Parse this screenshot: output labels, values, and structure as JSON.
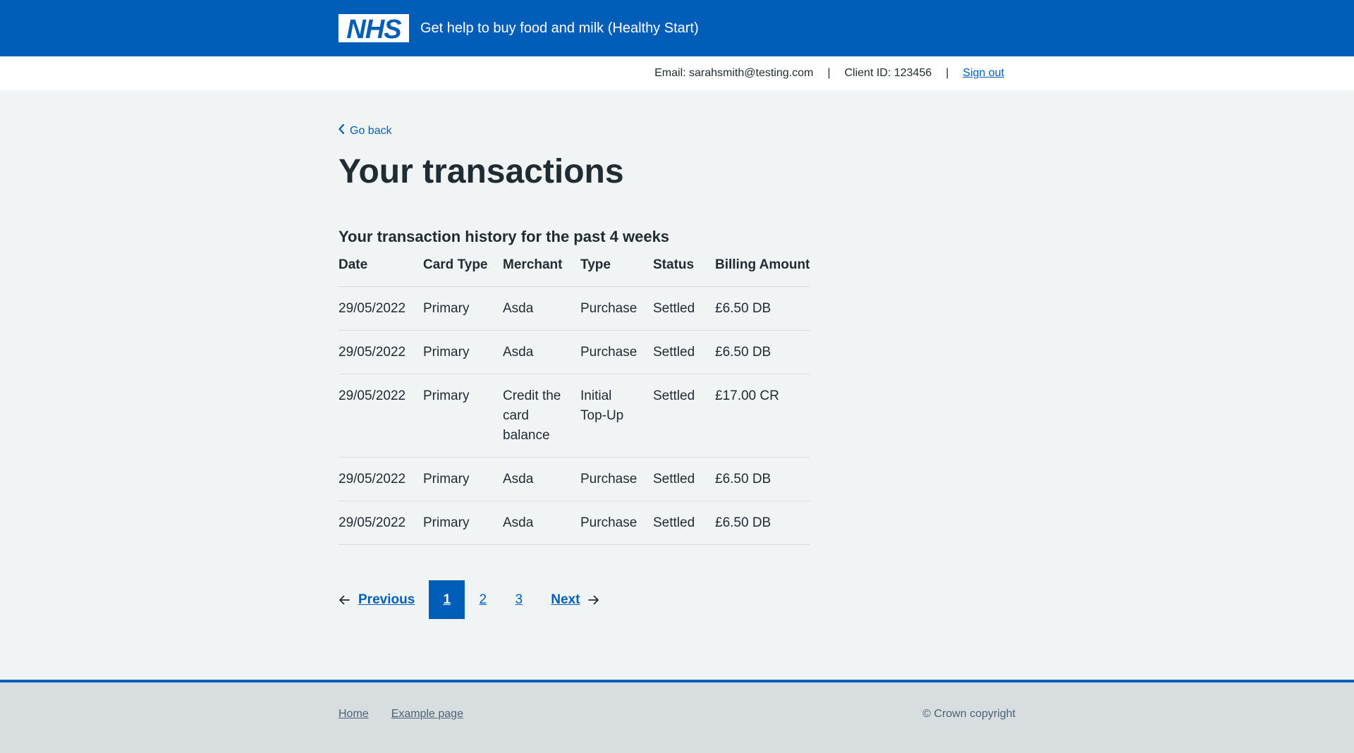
{
  "header": {
    "logo_text": "NHS",
    "service_name": "Get help to buy food and milk (Healthy Start)"
  },
  "account": {
    "email": "Email: sarahsmith@testing.com",
    "separator": "|",
    "client_id": "Client ID: 123456",
    "sign_out": "Sign out"
  },
  "back_link": "Go back",
  "page_title": "Your transactions",
  "table": {
    "caption": "Your transaction history for the past 4 weeks",
    "headers": [
      "Date",
      "Card Type",
      "Merchant",
      "Type",
      "Status",
      "Billing Amount"
    ],
    "rows": [
      [
        "29/05/2022",
        "Primary",
        "Asda",
        "Purchase",
        "Settled",
        "£6.50 DB"
      ],
      [
        "29/05/2022",
        "Primary",
        "Asda",
        "Purchase",
        "Settled",
        "£6.50 DB"
      ],
      [
        "29/05/2022",
        "Primary",
        "Credit the card balance",
        "Initial Top-Up",
        "Settled",
        "£17.00 CR"
      ],
      [
        "29/05/2022",
        "Primary",
        "Asda",
        "Purchase",
        "Settled",
        "£6.50 DB"
      ],
      [
        "29/05/2022",
        "Primary",
        "Asda",
        "Purchase",
        "Settled",
        "£6.50 DB"
      ]
    ]
  },
  "pagination": {
    "previous": "Previous",
    "pages": [
      "1",
      "2",
      "3"
    ],
    "current": "1",
    "next": "Next"
  },
  "footer": {
    "links": [
      "Home",
      "Example page"
    ],
    "copyright": "© Crown copyright"
  },
  "colors": {
    "brand_blue": "#005eb8",
    "page_bg": "#f0f4f5",
    "footer_bg": "#d8dde0",
    "text": "#212b32"
  }
}
